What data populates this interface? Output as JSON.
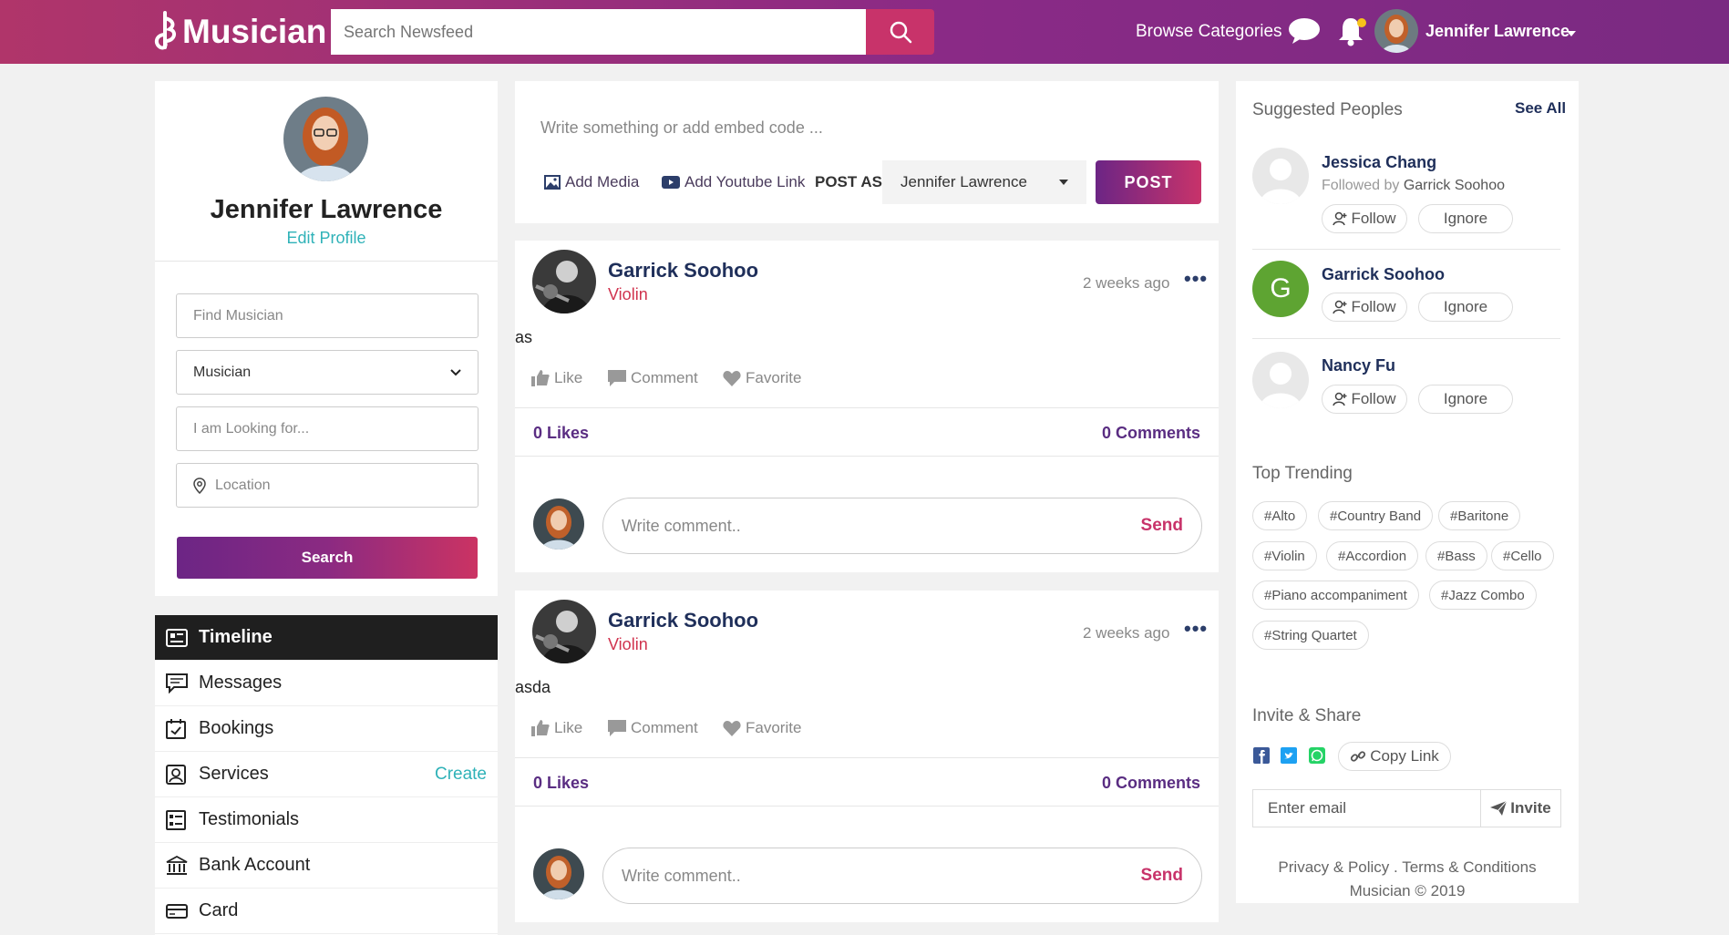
{
  "header": {
    "app_name": "Musician",
    "search_placeholder": "Search Newsfeed",
    "browse_label": "Browse Categories",
    "user_name": "Jennifer Lawrence"
  },
  "profile": {
    "name": "Jennifer Lawrence",
    "edit_label": "Edit Profile",
    "find_placeholder": "Find Musician",
    "type_selected": "Musician",
    "looking_placeholder": "I am Looking for...",
    "location_placeholder": "Location",
    "search_label": "Search"
  },
  "menu": {
    "items": [
      {
        "label": "Timeline",
        "icon": "timeline-icon"
      },
      {
        "label": "Messages",
        "icon": "messages-icon"
      },
      {
        "label": "Bookings",
        "icon": "bookings-icon"
      },
      {
        "label": "Services",
        "icon": "services-icon"
      },
      {
        "label": "Testimonials",
        "icon": "testimonials-icon"
      },
      {
        "label": "Bank Account",
        "icon": "bank-icon"
      },
      {
        "label": "Card",
        "icon": "card-icon"
      }
    ],
    "create_label": "Create"
  },
  "composer": {
    "placeholder": "Write something or add embed code ...",
    "add_media": "Add Media",
    "add_youtube": "Add Youtube Link",
    "post_as_label": "POST AS:",
    "post_as_value": "Jennifer Lawrence",
    "post_label": "POST"
  },
  "posts": [
    {
      "author": "Garrick Soohoo",
      "instrument": "Violin",
      "time": "2 weeks ago",
      "text": "as",
      "like": "Like",
      "comment": "Comment",
      "favorite": "Favorite",
      "likes": "0 Likes",
      "comments": "0 Comments",
      "comment_placeholder": "Write comment..",
      "send": "Send"
    },
    {
      "author": "Garrick Soohoo",
      "instrument": "Violin",
      "time": "2 weeks ago",
      "text": "asda",
      "like": "Like",
      "comment": "Comment",
      "favorite": "Favorite",
      "likes": "0 Likes",
      "comments": "0 Comments",
      "comment_placeholder": "Write comment..",
      "send": "Send"
    }
  ],
  "suggested": {
    "title": "Suggested Peoples",
    "see_all": "See All",
    "people": [
      {
        "name": "Jessica Chang",
        "followed_prefix": "Followed by",
        "followed_by": "Garrick Soohoo",
        "follow": "Follow",
        "ignore": "Ignore"
      },
      {
        "name": "Garrick Soohoo",
        "initial": "G",
        "follow": "Follow",
        "ignore": "Ignore"
      },
      {
        "name": "Nancy Fu",
        "follow": "Follow",
        "ignore": "Ignore"
      }
    ]
  },
  "trending": {
    "title": "Top Trending",
    "tags": [
      "#Alto",
      "#Country Band",
      "#Baritone",
      "#Violin",
      "#Accordion",
      "#Bass",
      "#Cello",
      "#Piano accompaniment",
      "#Jazz Combo",
      "#String Quartet"
    ]
  },
  "invite": {
    "title": "Invite & Share",
    "copy_link": "Copy Link",
    "email_placeholder": "Enter email",
    "invite_label": "Invite"
  },
  "footer": {
    "privacy": "Privacy & Policy",
    "dot": ".",
    "terms": "Terms & Conditions",
    "copyright": "Musician © 2019"
  },
  "colors": {
    "header_start": "#b0356a",
    "header_end": "#7a2a82",
    "accent_teal": "#2fb2b8",
    "accent_red": "#c8336a",
    "name_navy": "#1f2f5a"
  }
}
